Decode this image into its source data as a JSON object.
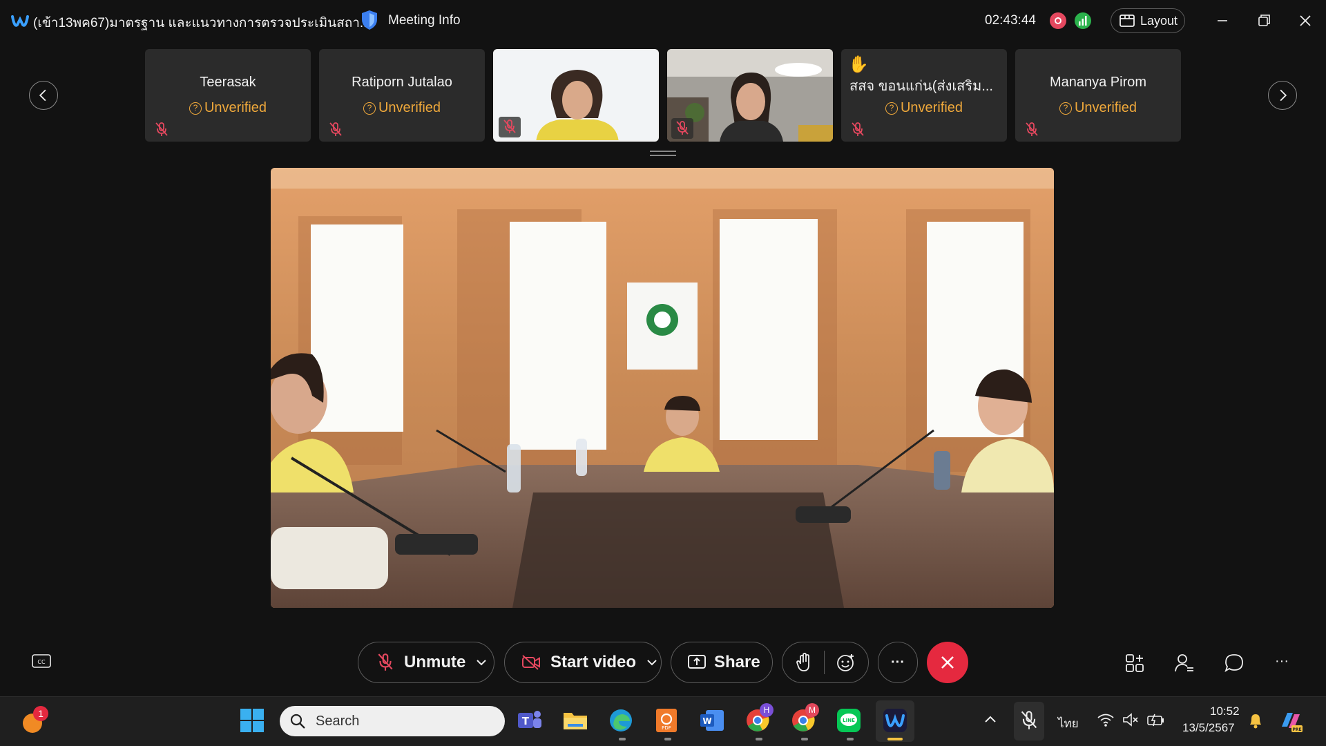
{
  "titlebar": {
    "meeting_title": "(เข้า13พค67)มาตรฐาน และแนวทางการตรวจประเมินสถา...",
    "meeting_info": "Meeting Info",
    "timer": "02:43:44",
    "layout_label": "Layout"
  },
  "participants": [
    {
      "name": "Teerasak",
      "status": "Unverified"
    },
    {
      "name": "Ratiporn Jutalao",
      "status": "Unverified"
    },
    {
      "name": "",
      "status": ""
    },
    {
      "name": "",
      "status": ""
    },
    {
      "name": "สสจ ขอนแก่น(ส่งเสริม...",
      "status": "Unverified",
      "hand_raised": "✋"
    },
    {
      "name": "Mananya Pirom",
      "status": "Unverified"
    }
  ],
  "controls": {
    "unmute": "Unmute",
    "start_video": "Start video",
    "share": "Share",
    "more": "···",
    "right_more": "···"
  },
  "taskbar": {
    "search_placeholder": "Search",
    "notification_count": "1",
    "teams_badge": "H",
    "chrome_badge": "M",
    "language": "ไทย",
    "time": "10:52",
    "date": "13/5/2567"
  },
  "colors": {
    "accent_unverified": "#f0a93b",
    "end_call": "#e5293f",
    "recording": "#e5485f",
    "signal": "#2bb24c"
  }
}
